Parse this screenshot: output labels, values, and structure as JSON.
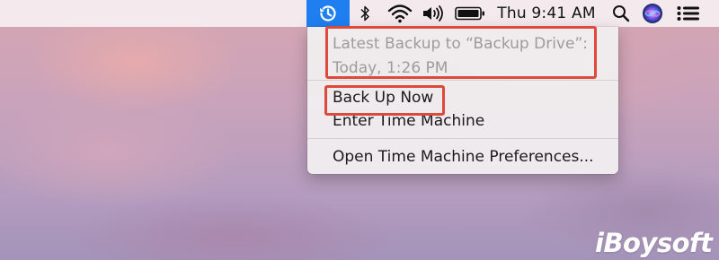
{
  "menubar": {
    "time_machine_icon": "time-machine-icon",
    "bluetooth_icon": "bluetooth-icon",
    "wifi_icon": "wifi-icon",
    "volume_icon": "volume-icon",
    "battery_icon": "battery-icon",
    "clock": "Thu 9:41 AM",
    "search_icon": "spotlight-search-icon",
    "siri_icon": "siri-icon",
    "notification_icon": "notification-center-icon",
    "accent_color": "#1f7ff0"
  },
  "time_machine_menu": {
    "status_line1": "Latest Backup to “Backup Drive”:",
    "status_line2": "Today, 1:26 PM",
    "items": [
      "Back Up Now",
      "Enter Time Machine",
      "Open Time Machine Preferences..."
    ],
    "highlight_color": "#dd4a3c"
  },
  "watermark": "iBoysoft"
}
